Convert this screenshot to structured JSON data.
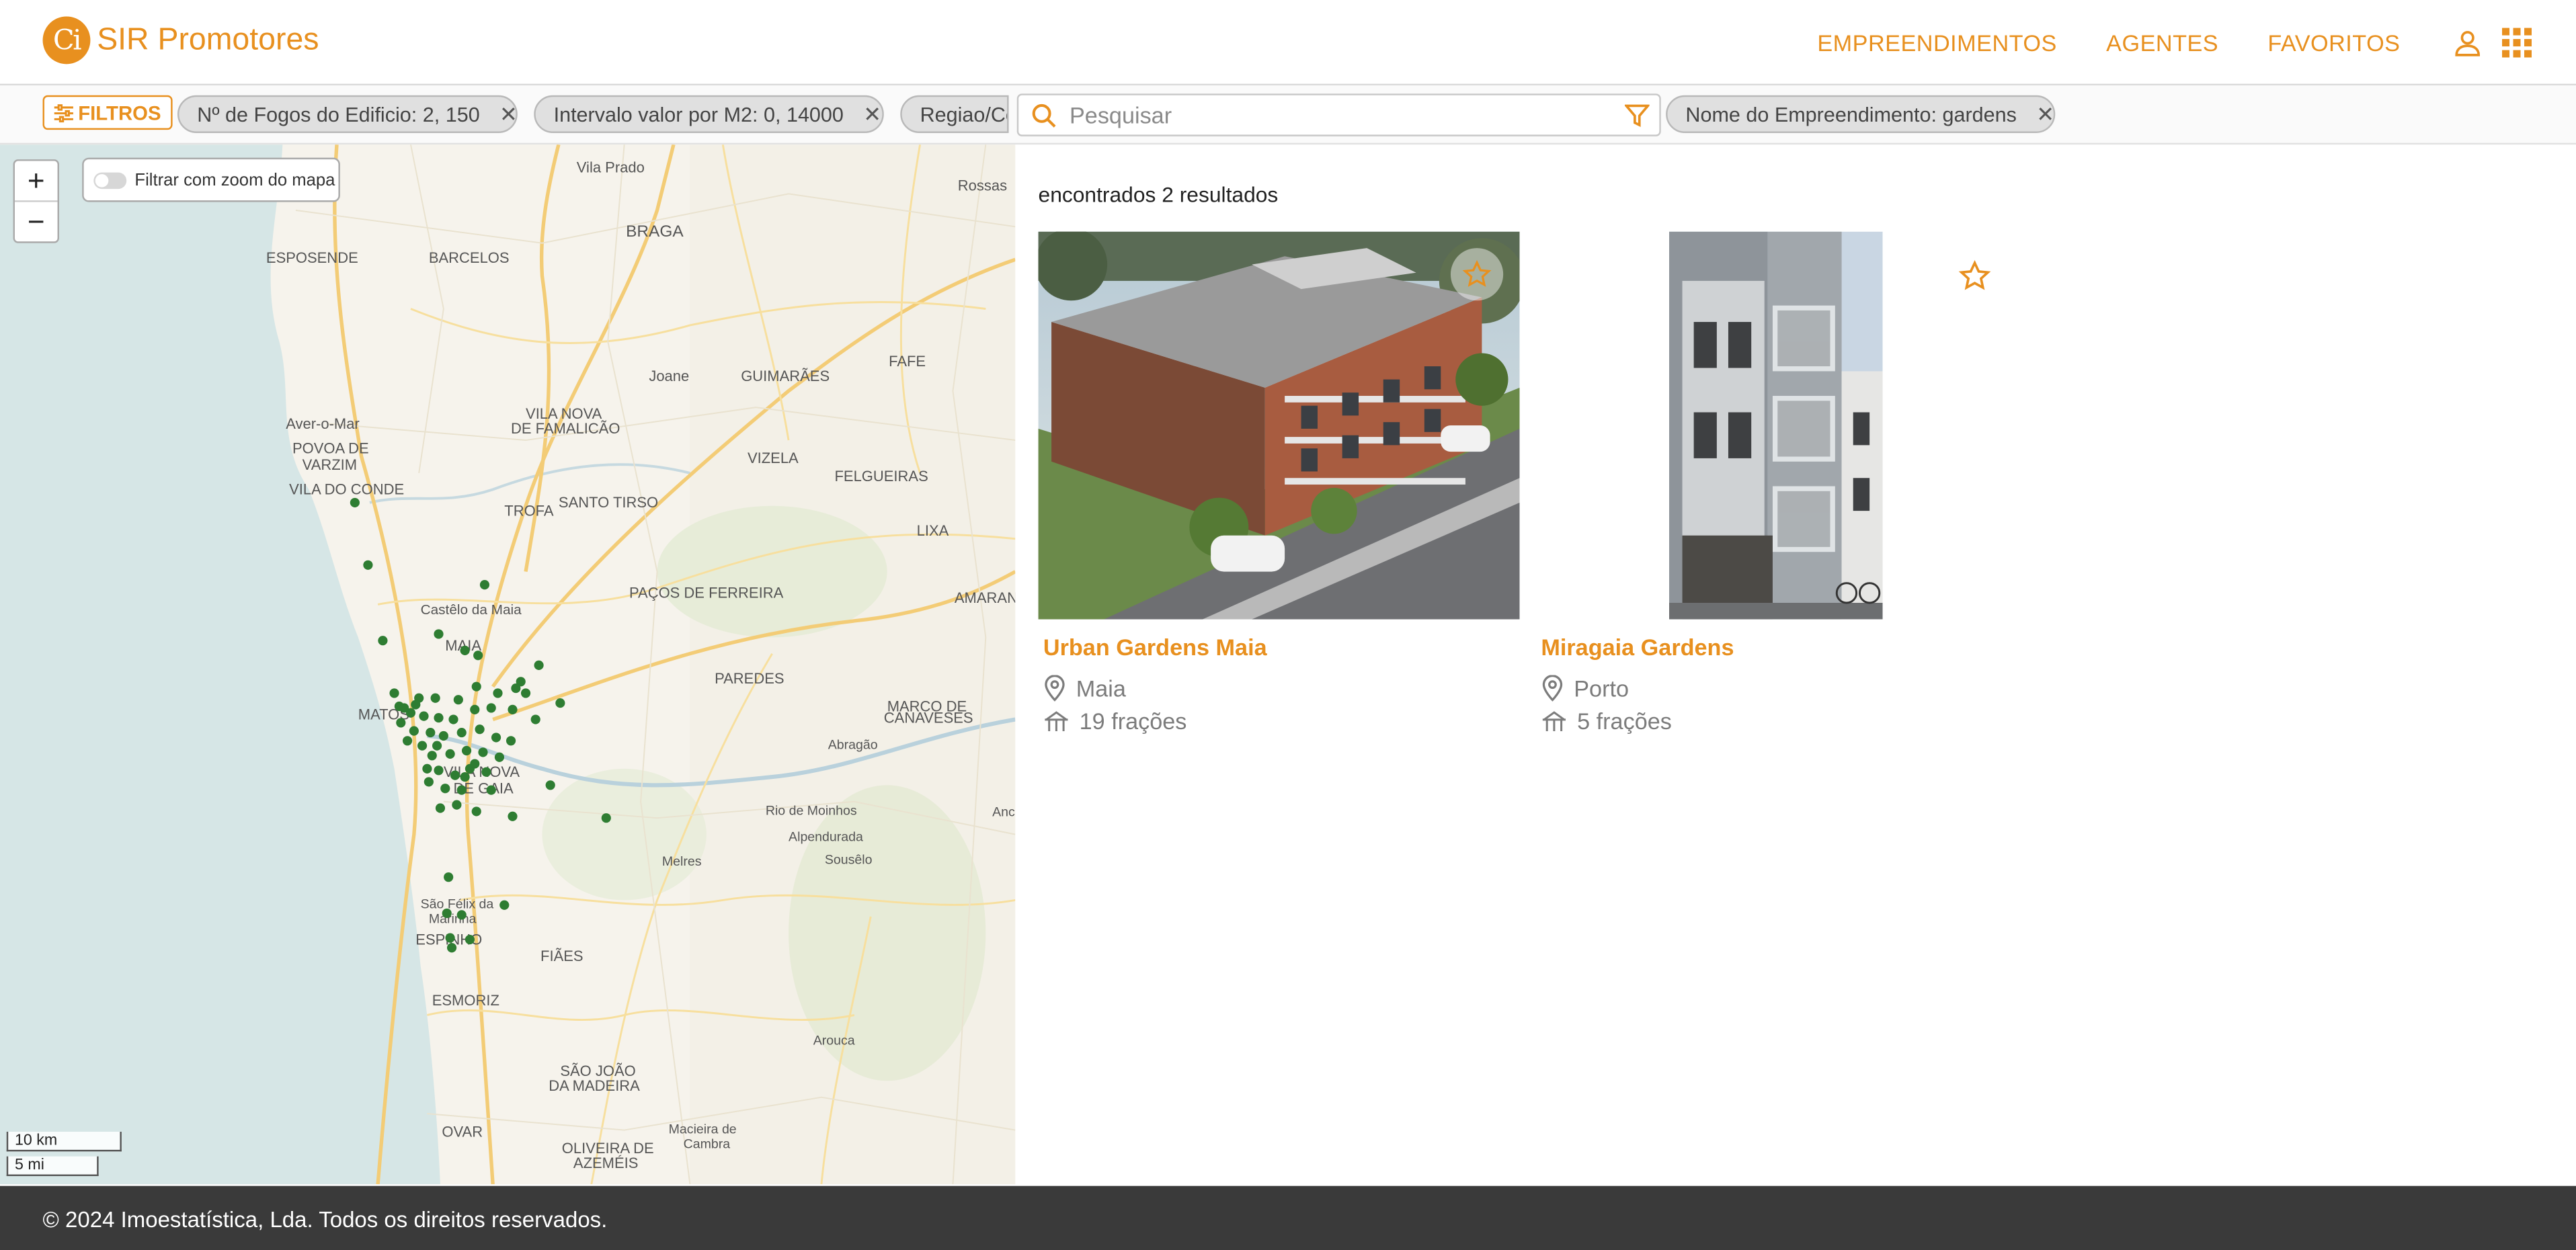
{
  "header": {
    "logo_mark": "Ci",
    "logo_text": "SIR Promotores",
    "nav": [
      "EMPREENDIMENTOS",
      "AGENTES",
      "FAVORITOS"
    ],
    "icons": [
      "user-icon",
      "apps-grid-icon"
    ]
  },
  "filterbar": {
    "filters_label": "FILTROS",
    "chips": [
      "Nº de Fogos do Edificio: 2, 150",
      "Intervalo valor por M2: 0, 14000",
      "Regiao/Co"
    ],
    "search_placeholder": "Pesquisar",
    "right_chip": "Nome do Empreendimento: gardens"
  },
  "map": {
    "zoom_in": "+",
    "zoom_out": "−",
    "zoom_filter_label": "Filtrar com zoom do mapa",
    "scale_km": "10 km",
    "scale_mi": "5 mi",
    "places": [
      "Vila Prado",
      "Rossas",
      "BRAGA",
      "ESPOSENDE",
      "BARCELOS",
      "FAFE",
      "Joane",
      "GUIMARÃES",
      "VILA NOVA",
      "DE FAMALICÃO",
      "Aver-o-Mar",
      "POVOA DE",
      "VARZIM",
      "VILA DO CONDE",
      "VIZELA",
      "FELGUEIRAS",
      "SANTO TIRSO",
      "TROFA",
      "LIXA",
      "PAÇOS DE FERREIRA",
      "AMARAN",
      "Castêlo da Maia",
      "MAIA",
      "PAREDES",
      "MATOS",
      "MARCO DE",
      "CANAVESES",
      "Abragão",
      "VILA NOVA",
      "DE GAIA",
      "Rio de Moinhos",
      "Alpendurada",
      "Sousêlo",
      "Melres",
      "São Félix da",
      "Marinha",
      "ESPINHO",
      "FIÃES",
      "ESMORIZ",
      "Arouca",
      "SÃO JOÃO",
      "DA MADEIRA",
      "OVAR",
      "Macieira de",
      "Cambra",
      "OLIVEIRA DE",
      "AZEMÉIS",
      "Anc"
    ],
    "marker_color": "#2e7d32"
  },
  "results": {
    "count_text": "encontrados 2 resultados",
    "items": [
      {
        "title": "Urban Gardens Maia",
        "location": "Maia",
        "units": "19 frações",
        "favorite": false
      },
      {
        "title": "Miragaia Gardens",
        "location": "Porto",
        "units": "5 frações",
        "favorite": false
      }
    ]
  },
  "footer": {
    "text": "© 2024 Imoestatística, Lda. Todos os direitos reservados."
  },
  "colors": {
    "accent": "#e8901f",
    "footer_bg": "#3a3a3a",
    "chip_bg": "#e0e0e0"
  }
}
